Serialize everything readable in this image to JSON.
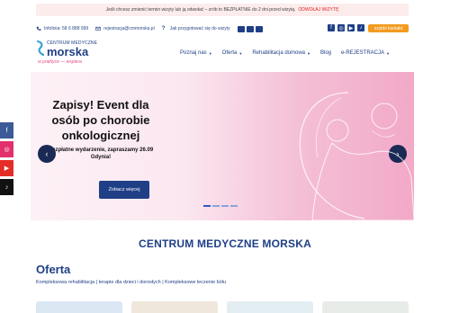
{
  "notice": {
    "text": "Jeśli chcesz zmienić termin wizyty lub ją odwołać – zrób to BEZPŁATNIE do 2 dni przed wizytą.",
    "link": "ODWOŁAJ WIZYTĘ"
  },
  "contact": {
    "phone": "Infolinia: 58 6 888 999",
    "email": "rejestracja@cmmorska.pl",
    "prepare": "Jak przygotować się do wizyty"
  },
  "socials": [
    "facebook-icon",
    "instagram-icon",
    "youtube-icon",
    "tiktok-icon"
  ],
  "cta_button": "szybki kontakt",
  "logo": {
    "line1": "CENTRUM MEDYCZNE",
    "line2": "morska",
    "tagline": "w praktyce — wspiera"
  },
  "nav": {
    "items": [
      {
        "label": "Poznaj nas",
        "dropdown": true
      },
      {
        "label": "Oferta",
        "dropdown": true
      },
      {
        "label": "Rehabilitacja domowa",
        "dropdown": true
      },
      {
        "label": "Blog",
        "dropdown": false
      },
      {
        "label": "e-REJESTRACJA",
        "dropdown": true
      }
    ]
  },
  "hero": {
    "title": "Zapisy! Event dla osób po chorobie onkologicznej",
    "subtitle": "Bezpłatne wydarzenie, zapraszamy 26.09 Gdynia!",
    "button": "Zobacz więcej",
    "slides": 4,
    "active_slide": 1
  },
  "side_socials": [
    "facebook-icon",
    "instagram-icon",
    "youtube-icon",
    "tiktok-icon"
  ],
  "main": {
    "heading": "CENTRUM MEDYCZNE MORSKA",
    "section_title": "Oferta",
    "section_subtitle": "Kompleksowa rehabilitacja | terapie dla dzieci i dorosłych | Kompleksowe leczenie bólu"
  },
  "colors": {
    "brand_blue": "#1f3f86",
    "accent_orange": "#f39b1f",
    "pink": "#e54c8a"
  }
}
